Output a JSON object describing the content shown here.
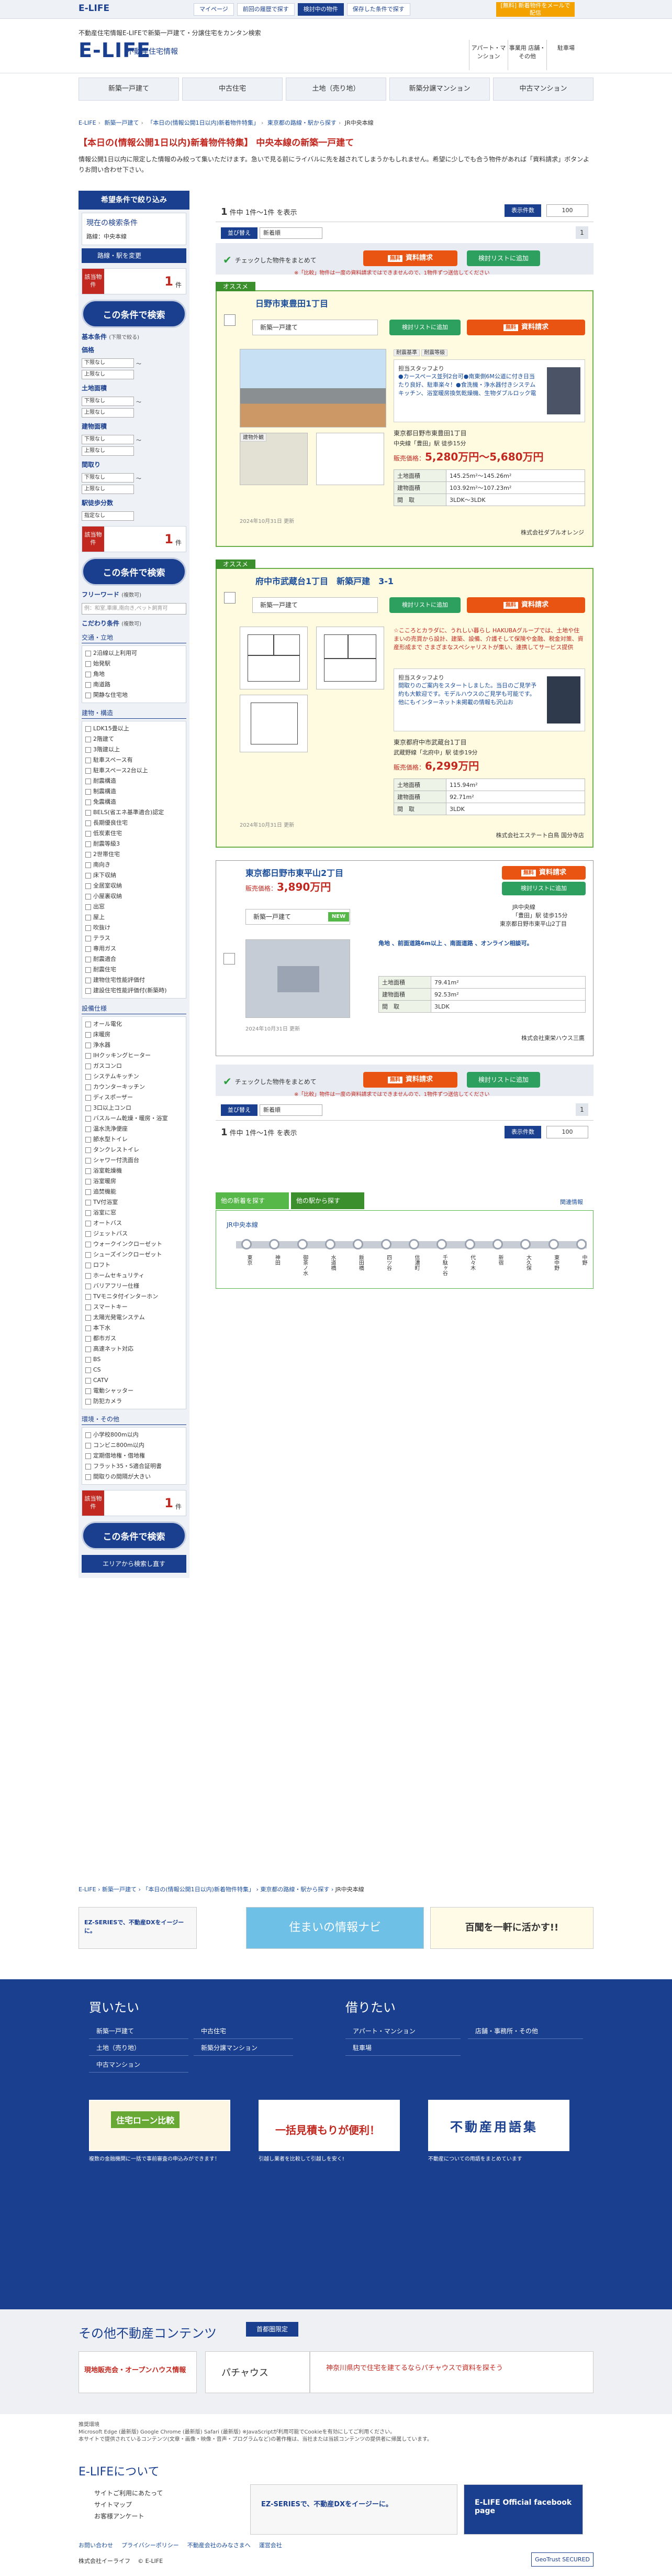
{
  "topbar": {
    "logo": "E-LIFE",
    "links": [
      "マイページ",
      "前回の履歴で探す",
      "検討中の物件",
      "保存した条件で探す"
    ],
    "promo": "[無料] 新着物件をメールで配信",
    "promo_flag": "便利"
  },
  "header": {
    "tagline": "不動産住宅情報E-LIFEで新築一戸建て・分譲住宅をカンタン検索",
    "logo": "E-LIFE",
    "logo_sub": "不動産住宅情報",
    "nav": [
      "アパート・マンション",
      "事業用 店舗・その他",
      "駐車場"
    ]
  },
  "gnav": [
    "新築一戸建て",
    "中古住宅",
    "土地（売り地）",
    "新築分譲マンション",
    "中古マンション"
  ],
  "breadcrumb": [
    "E-LIFE",
    "新築一戸建て",
    "「本日の(情報公開1日以内)新着物件特集」",
    "東京都の路線・駅から探す",
    "JR中央本線"
  ],
  "page_title": "【本日の(情報公開1日以内)新着物件特集】 中央本線の新築一戸建て",
  "intro": "情報公開1日以内に限定した情報のみ絞って集いただけます。急いで見る前にライバルに先を越されてしまうかもしれません。希望に少しでも合う物件があれば「資料請求」ボタンよりお問い合わせ下さい。",
  "sidebar": {
    "head": "希望条件で絞り込み",
    "current_title": "現在の検索条件",
    "current_value": "路線：中央本線",
    "change": "路線・駅を変更",
    "count_label": "該当物件",
    "count": "1",
    "count_unit": "件",
    "search": "この条件で検索",
    "basic": "基本条件",
    "basic_note": "(下限で絞る)",
    "price": "価格",
    "land": "土地面積",
    "building": "建物面積",
    "layout": "間取り",
    "walk": "駅徒歩分数",
    "min": "下限なし",
    "max": "上限なし",
    "tilde": "〜",
    "walk_val": "指定なし",
    "free": "フリーワード",
    "free_note": "(複数可)",
    "free_ph": "例：和室,車庫,南向き,ペット飼育可",
    "kodawari": "こだわり条件",
    "kodawari_note": "(複数可)",
    "cat_traffic": "交通・立地",
    "traffic": [
      "2沿線以上利用可",
      "始発駅",
      "角地",
      "南道路",
      "閑静な住宅地"
    ],
    "cat_building": "建物・構造",
    "building_items": [
      "LDK15畳以上",
      "2階建て",
      "3階建以上",
      "駐車スペース有",
      "駐車スペース2台以上",
      "耐震構造",
      "制震構造",
      "免震構造",
      "BELS(省エネ基準適合)認定",
      "長期優良住宅",
      "低炭素住宅",
      "耐震等級3",
      "2世帯住宅",
      "南向き",
      "床下収納",
      "全居室収納",
      "小屋裏収納",
      "出窓",
      "屋上",
      "吹抜け",
      "テラス",
      "専用ガス",
      "耐震適合",
      "耐震住宅",
      "建物住宅性能評価付",
      "建設住宅性能評価付(新築時)"
    ],
    "cat_equip": "設備仕様",
    "equip_items": [
      "オール電化",
      "床暖房",
      "浄水器",
      "IHクッキングヒーター",
      "ガスコンロ",
      "システムキッチン",
      "カウンターキッチン",
      "ディスポーザー",
      "3口以上コンロ",
      "バスルーム乾燥・暖房・浴室",
      "温水洗浄便座",
      "節水型トイレ",
      "タンクレストイレ",
      "シャワー付洗面台",
      "浴室乾燥機",
      "浴室暖房",
      "追焚機能",
      "TV付浴室",
      "浴室に窓",
      "オートバス",
      "ジェットバス",
      "ウォークインクローゼット",
      "シューズインクローゼット",
      "ロフト",
      "ホームセキュリティ",
      "バリアフリー仕様",
      "TVモニタ付インターホン",
      "スマートキー",
      "太陽光発電システム",
      "本下水",
      "都市ガス",
      "高速ネット対応",
      "BS",
      "CS",
      "CATV",
      "電動シャッター",
      "防犯カメラ"
    ],
    "cat_env": "環境・その他",
    "env_items": [
      "小学校800m以内",
      "コンビニ800m以内",
      "定期借地権・借地権",
      "フラット35・S適合証明書",
      "間取りの間隔が大きい"
    ],
    "reset": "エリアから検索し直す"
  },
  "results": {
    "count_pre": "1",
    "count_mid": "件中",
    "count_range": "1件～1件",
    "count_post": "を表示",
    "order": "表示件数",
    "page_size": "100",
    "sort_label": "並び替え",
    "sort_value": "新着順",
    "page": "1",
    "bulk_check": "チェックした物件をまとめて",
    "request_tag": "無料",
    "request": "資料請求",
    "list_btn": "検討リストに追加",
    "note": "※「比較」物件は一度の資料請求ではできませんので、1物件ずつ送信してください"
  },
  "listings": [
    {
      "badge": "オススメ",
      "title": "日野市東豊田1丁目",
      "type": "新築一戸建て",
      "photo_tag": "建物外観",
      "list_btn": "検討リストに追加",
      "req_tag": "無料",
      "req": "資料請求",
      "chip1": "耐震基準",
      "chip2": "耐震等級",
      "staff_label": "担当スタッフより",
      "staff_text": "●カースペース並列2台可●南東側6M公道に付き日当たり良好、駐車楽々！●食洗機・浄水器付きシステムキッチン、浴室暖房換気乾燥機、生物ダブルロック電",
      "address": "東京都日野市東豊田1丁目",
      "station": "中央線「豊田」駅 徒歩15分",
      "price_label": "販売価格：",
      "price": "5,280万円～5,680万円",
      "land_label": "土地面積",
      "land": "145.25m²～145.26m²",
      "bldg_label": "建物面積",
      "bldg": "103.92m²～107.23m²",
      "layout_label": "間　取",
      "layout": "3LDK～3LDK",
      "updated": "2024年10月31日 更新",
      "company": "株式会社ダブルオレンジ"
    },
    {
      "badge": "オススメ",
      "title": "府中市武蔵台1丁目　新築戸建　3-1",
      "type": "新築一戸建て",
      "list_btn": "検討リストに追加",
      "req_tag": "無料",
      "req": "資料請求",
      "headline": "☆こころとカラダに、うれしい暮らし HAKUBAグループでは、土地や住まいの売買から設計、建築、設備、介護そして保険や金融、税金対策、資産形成まで さまざまなスペシャリストが集い、連携してサービス提供",
      "staff_label": "担当スタッフより",
      "staff_text": "間取りのご案内をスタートしました。当日のご見学予約も大歓迎です。モデルハウスのご見学も可能です。他にもインターネット未掲載の情報も沢山お",
      "address": "東京都府中市武蔵台1丁目",
      "station": "武蔵野線「北府中」駅 徒歩19分",
      "price_label": "販売価格：",
      "price": "6,299万円",
      "land_label": "土地面積",
      "land": "115.94m²",
      "bldg_label": "建物面積",
      "bldg": "92.71m²",
      "layout_label": "間　取",
      "layout": "3LDK",
      "updated": "2024年10月31日 更新",
      "company": "株式会社エステート白鳥 国分寺店"
    },
    {
      "title": "東京都日野市東平山2丁目",
      "price_label": "販売価格：",
      "price": "3,890万円",
      "type": "新築一戸建て",
      "new": "NEW",
      "req_tag": "無料",
      "req": "資料請求",
      "list_btn": "検討リストに追加",
      "station_line": "JR中央線",
      "station": "「豊田」駅 徒歩15分",
      "address": "東京都日野市東平山2丁目",
      "headline": "角地 、前面道路6m以上 、南面道路 、オンライン相談可。",
      "land_label": "土地面積",
      "land": "79.41m²",
      "bldg_label": "建物面積",
      "bldg": "92.53m²",
      "layout_label": "間　取",
      "layout": "3LDK",
      "updated": "2024年10月31日 更新",
      "company": "株式会社東栄ハウス三鷹"
    }
  ],
  "line_tabs": {
    "tab1": "他の新着を探す",
    "tab2": "他の駅から探す",
    "related": "関連情報"
  },
  "line": {
    "name": "JR中央本線",
    "stations": [
      "東京",
      "神田",
      "御茶ノ水",
      "水道橋",
      "飯田橋",
      "四ツ谷",
      "信濃町",
      "千駄ヶ谷",
      "代々木",
      "新宿",
      "大久保",
      "東中野",
      "中野"
    ]
  },
  "breadcrumb_bottom": [
    "E-LIFE",
    "新築一戸建て",
    "「本日の(情報公開1日以内)新着物件特集」",
    "東京都の路線・駅から探す",
    "JR中央本線"
  ],
  "banners": [
    "EZ-SERIESで、不動産DXをイージーに。",
    "住まいの情報ナビ",
    "百聞を一軒に活かす!!"
  ],
  "footer": {
    "buy_title": "買いたい",
    "buy_links": [
      "新築一戸建て",
      "中古住宅",
      "土地（売り地）",
      "新築分譲マンション",
      "中古マンション"
    ],
    "rent_title": "借りたい",
    "rent_links": [
      "アパート・マンション",
      "店舗・事務所・その他",
      "駐車場"
    ],
    "b1": "住宅ローン比較",
    "b1_sub": "複数の金融機関に一括で事前審査の申込みができます！",
    "b2": "一括見積もりが便利！",
    "b2_sub": "引越し業者を比較して引越しを安く!",
    "b3": "不動産用語集",
    "b3_sub": "不動産についての用語をまとめています"
  },
  "other": {
    "title": "その他不動産コンテンツ",
    "badge": "首都圏限定",
    "o1": "現地販売会・オープンハウス情報",
    "o2": "パチャウス",
    "o3": "神奈川県内で住宅を建てるならパチャウスで資料を探そう"
  },
  "disclaimer": "推奨環境\nMicrosoft Edge (最新版) Google Chrome (最新版) Safari (最新版) ※JavaScriptが利用可能でCookieを有効にしてご利用ください。\n本サイトで提供されているコンテンツ(文章・画像・映像・音声・プログラムなど)の著作権は、当社または当該コンテンツの提供者に帰属しています。",
  "about": {
    "title": "E-LIFEについて",
    "links": [
      "サイトご利用にあたって",
      "サイトマップ",
      "お客様アンケート"
    ],
    "ezs": "EZ-SERIESで、不動産DXをイージーに。",
    "fb": "E-LIFE Official facebook page"
  },
  "legal": [
    "お問い合わせ",
    "プライバシーポリシー",
    "不動産会社のみなさまへ",
    "運営会社"
  ],
  "bottom": {
    "company": "株式会社イーライフ",
    "copyright": "© E-LIFE",
    "geotrust": "GeoTrust SECURED"
  }
}
